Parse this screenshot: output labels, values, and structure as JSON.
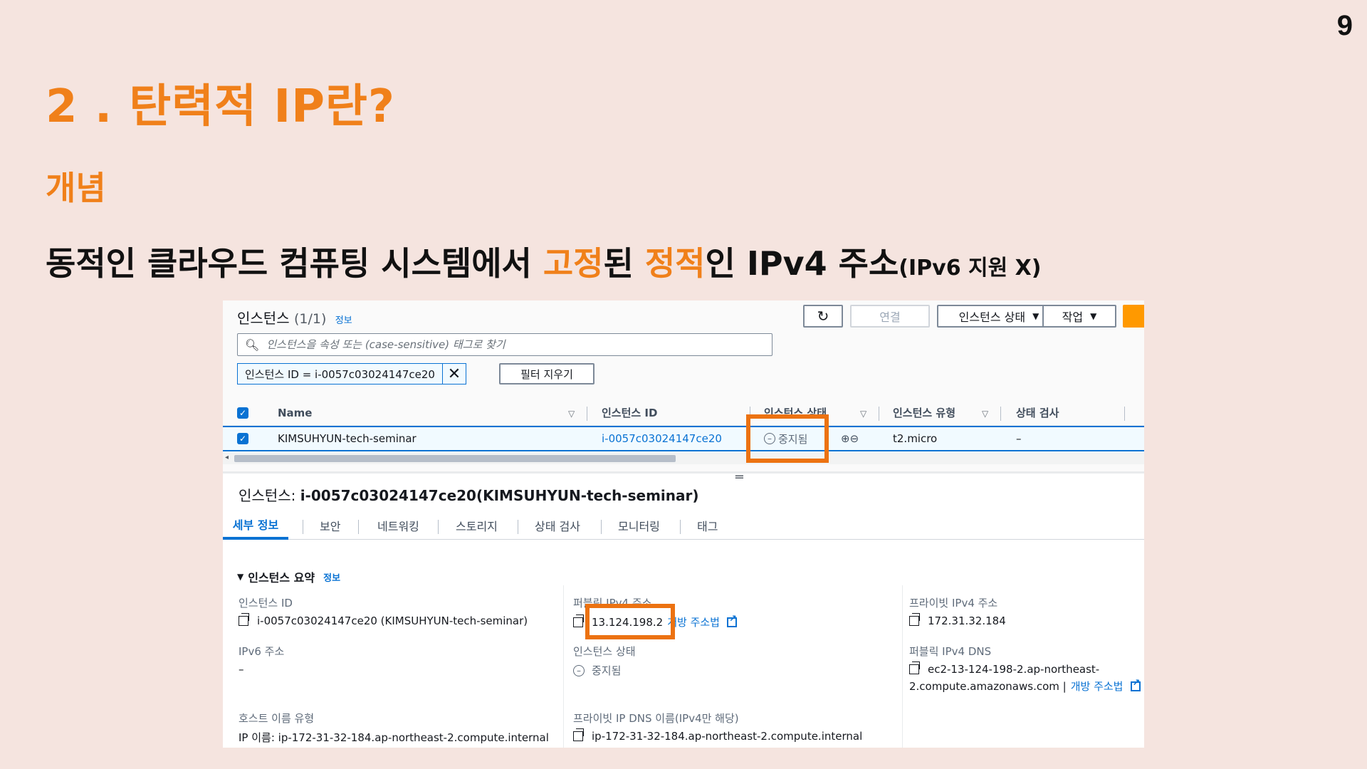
{
  "slide": {
    "page_number": "9",
    "title": "2 . 탄력적 IP란?",
    "subtitle": "개념",
    "desc_parts": [
      "동적인 클라우드 컴퓨팅 시스템에서 ",
      "고정",
      "된 ",
      "정적",
      "인 IPv4 주소",
      "(IPv6 지원 X)"
    ]
  },
  "console": {
    "header": {
      "title": "인스턴스",
      "count": "(1/1)",
      "info_link": "정보"
    },
    "buttons": {
      "connect": "연결",
      "instance_state": "인스턴스 상태",
      "actions": "작업"
    },
    "search_placeholder": "인스턴스을 속성 또는 (case-sensitive) 태그로 찾기",
    "filter_token": "인스턴스 ID = i-0057c03024147ce20",
    "clear_filters": "필터 지우기",
    "table": {
      "columns": [
        "Name",
        "인스턴스 ID",
        "인스턴스 상태",
        "인스턴스 유형",
        "상태 검사"
      ],
      "row": {
        "name": "KIMSUHYUN-tech-seminar",
        "instance_id": "i-0057c03024147ce20",
        "state": "중지됨",
        "type": "t2.micro",
        "status_check": "–"
      }
    },
    "detail": {
      "title_prefix": "인스턴스: ",
      "title_value": "i-0057c03024147ce20(KIMSUHYUN-tech-seminar)",
      "tabs": [
        "세부 정보",
        "보안",
        "네트워킹",
        "스토리지",
        "상태 검사",
        "모니터링",
        "태그"
      ],
      "summary_title": "인스턴스 요약",
      "summary_info": "정보",
      "fields": {
        "instance_id_label": "인스턴스 ID",
        "instance_id_value": "i-0057c03024147ce20 (KIMSUHYUN-tech-seminar)",
        "public_ipv4_label": "퍼블릭 IPv4 주소",
        "public_ipv4_value": "13.124.198.2",
        "open_address": "개방 주소법",
        "private_ipv4_label": "프라이빗 IPv4 주소",
        "private_ipv4_value": "172.31.32.184",
        "ipv6_label": "IPv6 주소",
        "ipv6_value": "–",
        "instance_state_label": "인스턴스 상태",
        "instance_state_value": "중지됨",
        "public_dns_label": "퍼블릭 IPv4 DNS",
        "public_dns_line1": "ec2-13-124-198-2.ap-northeast-",
        "public_dns_line2": "2.compute.amazonaws.com |",
        "public_dns_link": "개방 주소법",
        "hostname_type_label": "호스트 이름 유형",
        "hostname_type_value": "IP 이름: ip-172-31-32-184.ap-northeast-2.compute.internal",
        "private_dns_label": "프라이빗 IP DNS 이름(IPv4만 해당)",
        "private_dns_value": "ip-172-31-32-184.ap-northeast-2.compute.internal"
      }
    }
  },
  "colors": {
    "accent_orange": "#f0801a",
    "highlight_box": "#ec7211",
    "aws_blue": "#0972d3",
    "aws_orange": "#ff9900",
    "background": "#f5e4df"
  }
}
